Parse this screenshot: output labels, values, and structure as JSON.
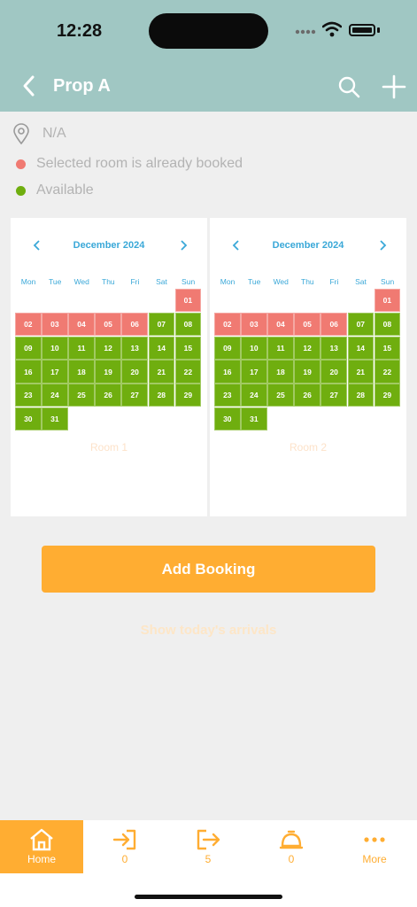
{
  "status_bar": {
    "time": "12:28"
  },
  "header": {
    "title": "Prop A"
  },
  "info": {
    "location": "N/A",
    "legend": [
      {
        "label": "Selected room is already booked",
        "color": "#f07a72"
      },
      {
        "label": "Available",
        "color": "#6fae0f"
      }
    ]
  },
  "calendars": [
    {
      "month": "December 2024",
      "weekdays": [
        "Mon",
        "Tue",
        "Wed",
        "Thu",
        "Fri",
        "Sat",
        "Sun"
      ],
      "room": "Room 1",
      "days": [
        {
          "d": "01",
          "s": "booked"
        },
        {
          "d": "02",
          "s": "booked"
        },
        {
          "d": "03",
          "s": "booked"
        },
        {
          "d": "04",
          "s": "booked"
        },
        {
          "d": "05",
          "s": "booked"
        },
        {
          "d": "06",
          "s": "booked"
        },
        {
          "d": "07",
          "s": "avail"
        },
        {
          "d": "08",
          "s": "avail"
        },
        {
          "d": "09",
          "s": "avail"
        },
        {
          "d": "10",
          "s": "avail"
        },
        {
          "d": "11",
          "s": "avail"
        },
        {
          "d": "12",
          "s": "avail"
        },
        {
          "d": "13",
          "s": "avail"
        },
        {
          "d": "14",
          "s": "avail"
        },
        {
          "d": "15",
          "s": "avail"
        },
        {
          "d": "16",
          "s": "avail"
        },
        {
          "d": "17",
          "s": "avail"
        },
        {
          "d": "18",
          "s": "avail"
        },
        {
          "d": "19",
          "s": "avail"
        },
        {
          "d": "20",
          "s": "avail"
        },
        {
          "d": "21",
          "s": "avail"
        },
        {
          "d": "22",
          "s": "avail"
        },
        {
          "d": "23",
          "s": "avail"
        },
        {
          "d": "24",
          "s": "avail"
        },
        {
          "d": "25",
          "s": "avail"
        },
        {
          "d": "26",
          "s": "avail"
        },
        {
          "d": "27",
          "s": "avail"
        },
        {
          "d": "28",
          "s": "avail"
        },
        {
          "d": "29",
          "s": "avail"
        },
        {
          "d": "30",
          "s": "avail"
        },
        {
          "d": "31",
          "s": "avail"
        }
      ]
    },
    {
      "month": "December 2024",
      "weekdays": [
        "Mon",
        "Tue",
        "Wed",
        "Thu",
        "Fri",
        "Sat",
        "Sun"
      ],
      "room": "Room 2",
      "days": [
        {
          "d": "01",
          "s": "booked"
        },
        {
          "d": "02",
          "s": "booked"
        },
        {
          "d": "03",
          "s": "booked"
        },
        {
          "d": "04",
          "s": "booked"
        },
        {
          "d": "05",
          "s": "booked"
        },
        {
          "d": "06",
          "s": "booked"
        },
        {
          "d": "07",
          "s": "avail"
        },
        {
          "d": "08",
          "s": "avail"
        },
        {
          "d": "09",
          "s": "avail"
        },
        {
          "d": "10",
          "s": "avail"
        },
        {
          "d": "11",
          "s": "avail"
        },
        {
          "d": "12",
          "s": "avail"
        },
        {
          "d": "13",
          "s": "avail"
        },
        {
          "d": "14",
          "s": "avail"
        },
        {
          "d": "15",
          "s": "avail"
        },
        {
          "d": "16",
          "s": "avail"
        },
        {
          "d": "17",
          "s": "avail"
        },
        {
          "d": "18",
          "s": "avail"
        },
        {
          "d": "19",
          "s": "avail"
        },
        {
          "d": "20",
          "s": "avail"
        },
        {
          "d": "21",
          "s": "avail"
        },
        {
          "d": "22",
          "s": "avail"
        },
        {
          "d": "23",
          "s": "avail"
        },
        {
          "d": "24",
          "s": "avail"
        },
        {
          "d": "25",
          "s": "avail"
        },
        {
          "d": "26",
          "s": "avail"
        },
        {
          "d": "27",
          "s": "avail"
        },
        {
          "d": "28",
          "s": "avail"
        },
        {
          "d": "29",
          "s": "avail"
        },
        {
          "d": "30",
          "s": "avail"
        },
        {
          "d": "31",
          "s": "avail"
        }
      ]
    }
  ],
  "actions": {
    "add_booking": "Add Booking",
    "show_arrivals": "Show today's arrivals"
  },
  "tabbar": {
    "items": [
      {
        "label": "Home",
        "icon": "home-icon"
      },
      {
        "label": "0",
        "icon": "check-in-icon"
      },
      {
        "label": "5",
        "icon": "check-out-icon"
      },
      {
        "label": "0",
        "icon": "service-bell-icon"
      },
      {
        "label": "More",
        "icon": "more-dots-icon"
      }
    ]
  },
  "colors": {
    "header": "#a0c7c3",
    "accent": "#ffad32",
    "calendar_text": "#3aa8d8"
  }
}
